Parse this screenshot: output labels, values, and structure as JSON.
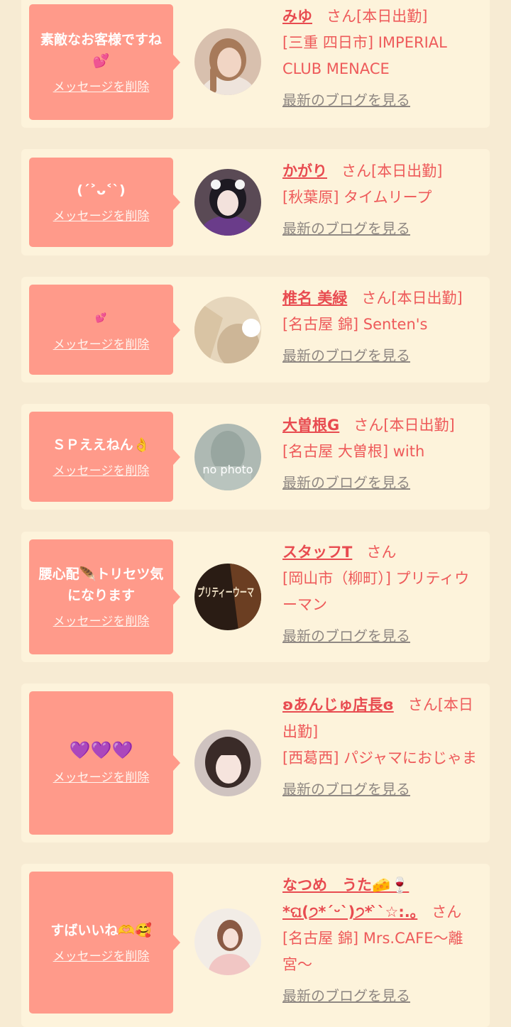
{
  "delete_label": "メッセージを削除",
  "blog_label": "最新のブログを見る",
  "cards": [
    {
      "message": "素敵なお客様ですね",
      "message_emoji": "💕",
      "name": "みゆ",
      "suffix": "さん[本日出勤]",
      "shop": "[三重 四日市] IMPERIAL CLUB MENACE",
      "avatar_icon": "woman-portrait-icon"
    },
    {
      "message": "(ˊ˃ᴗ˂ˋ)",
      "message_emoji": "",
      "name": "かがり",
      "suffix": "さん[本日出勤]",
      "shop": "[秋葉原] タイムリープ",
      "avatar_icon": "woman-portrait-icon"
    },
    {
      "message": "",
      "message_emoji": "💕",
      "name": "椎名 美緑",
      "suffix": "さん[本日出勤]",
      "shop": "[名古屋 錦] Senten's",
      "avatar_icon": "woman-portrait-icon"
    },
    {
      "message": "ＳＰええねん",
      "message_emoji": "👌",
      "name": "大曽根G",
      "suffix": "さん[本日出勤]",
      "shop": "[名古屋 大曽根] with",
      "avatar_icon": "no-photo-icon",
      "avatar_text": "no photo"
    },
    {
      "message": "腰心配🪶トリセツ気になります",
      "message_emoji": "",
      "name": "スタッフT",
      "suffix": "さん",
      "shop": "[岡山市（柳町）] プリティウーマン",
      "avatar_icon": "shop-logo-icon",
      "avatar_text": "プリティーウーマ"
    },
    {
      "message": "",
      "message_emoji": "💜💜💜",
      "name": "ʚあんじゅ店長ɞ",
      "suffix": "さん[本日出勤]",
      "shop": "[西葛西] パジャマにおじゃま",
      "avatar_icon": "woman-portrait-icon"
    },
    {
      "message": "すばいいね",
      "message_emoji": "🫶🥰",
      "name": "なつめ　うた🧀🍷 *ଘ(੭*ˊᵕˋ)੭* ̀ˋ☆:.｡",
      "suffix": "さん",
      "shop": "[名古屋 錦] Mrs.CAFE〜離宮〜",
      "avatar_icon": "woman-portrait-icon"
    }
  ],
  "colors": {
    "background": "#f7ebd3",
    "card": "#fdf3db",
    "bubble": "#ff9a8a",
    "name": "#e84b50",
    "blog_link": "#8f8883"
  }
}
